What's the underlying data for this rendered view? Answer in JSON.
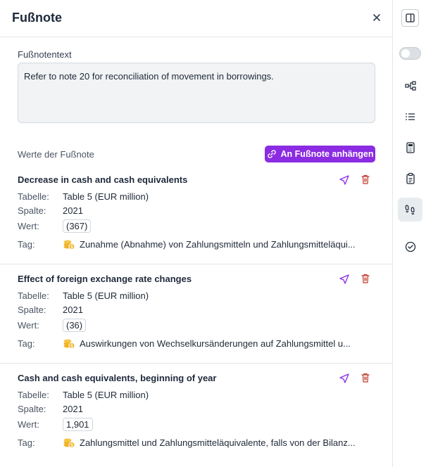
{
  "header": {
    "title": "Fußnote"
  },
  "footnote": {
    "text_label": "Fußnotentext",
    "text_value": "Refer to note 20 for reconciliation of movement in borrowings."
  },
  "values": {
    "label": "Werte der Fußnote",
    "attach_label": "An Fußnote anhängen"
  },
  "field_labels": {
    "table": "Tabelle:",
    "column": "Spalte:",
    "value": "Wert:",
    "tag": "Tag:"
  },
  "entries": [
    {
      "title": "Decrease in cash and cash equivalents",
      "table": "Table 5 (EUR million)",
      "column": "2021",
      "value": "(367)",
      "tag": "Zunahme (Abnahme) von Zahlungsmitteln und Zahlungsmitteläqui..."
    },
    {
      "title": "Effect of foreign exchange rate changes",
      "table": "Table 5 (EUR million)",
      "column": "2021",
      "value": "(36)",
      "tag": "Auswirkungen von Wechselkursänderungen auf Zahlungsmittel u..."
    },
    {
      "title": "Cash and cash equivalents, beginning of year",
      "table": "Table 5 (EUR million)",
      "column": "2021",
      "value": "1,901",
      "tag": "Zahlungsmittel und Zahlungsmitteläquivalente, falls von der Bilanz..."
    }
  ],
  "rail_icons": [
    "panel-layout-icon",
    "toggle-switch",
    "hierarchy-icon",
    "list-icon",
    "calculator-icon",
    "clipboard-icon",
    "footnote-icon",
    "check-circle-icon"
  ],
  "colors": {
    "accent": "#8b2be2",
    "delete": "#c0392b",
    "coin": "#f0b429"
  }
}
